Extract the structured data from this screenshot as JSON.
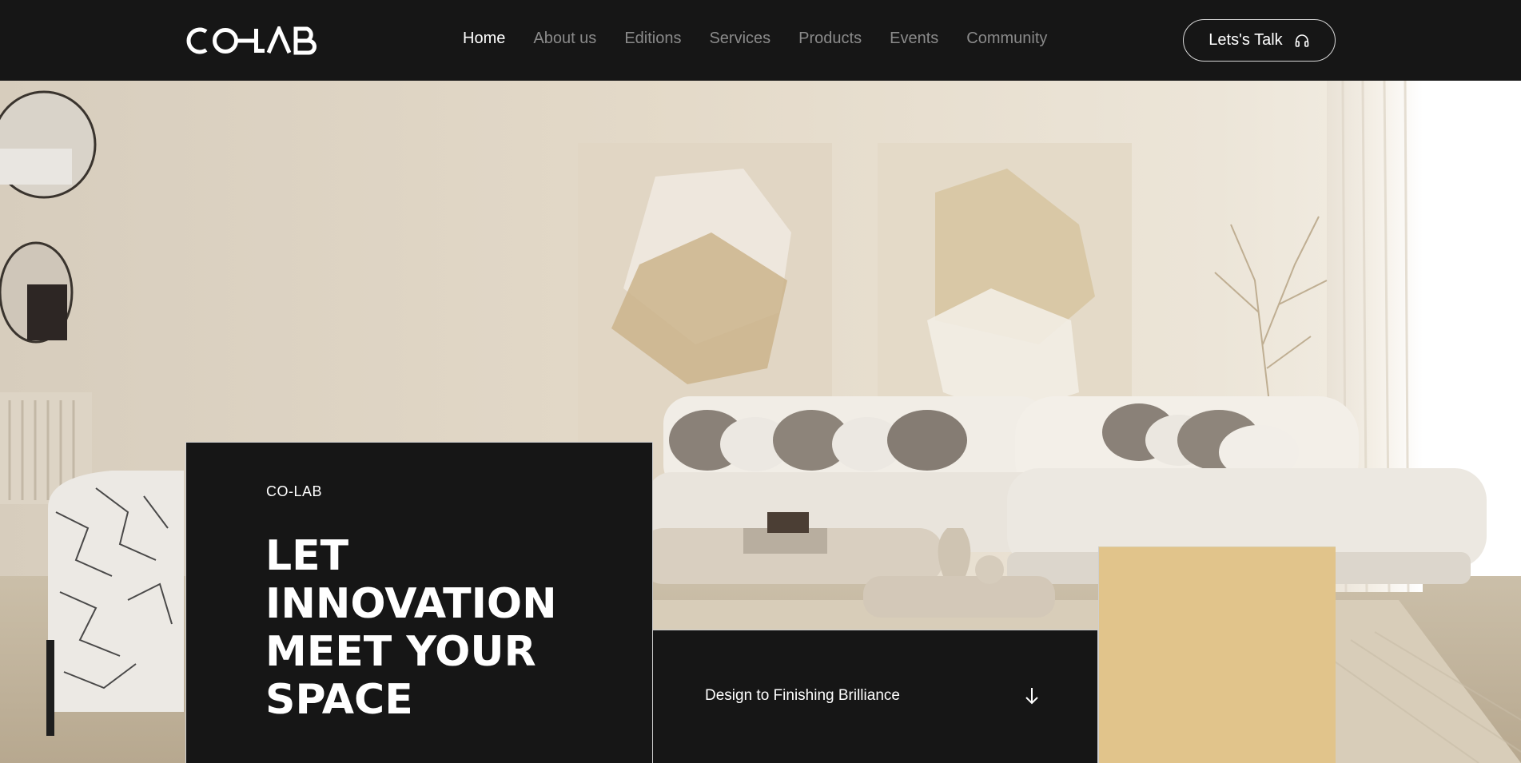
{
  "brand": {
    "logo_text": "CO—LAB"
  },
  "nav": {
    "items": [
      {
        "label": "Home",
        "active": true
      },
      {
        "label": "About us",
        "active": false
      },
      {
        "label": "Editions",
        "active": false
      },
      {
        "label": "Services",
        "active": false
      },
      {
        "label": "Products",
        "active": false
      },
      {
        "label": "Events",
        "active": false
      },
      {
        "label": "Community",
        "active": false
      }
    ]
  },
  "cta": {
    "label": "Lets's Talk",
    "icon": "headphones-icon"
  },
  "hero": {
    "eyebrow": "CO-LAB",
    "headline": "LET INNOVATION MEET YOUR SPACE",
    "sub_card_label": "Design to Finishing Brilliance",
    "sub_card_icon": "arrow-down-icon"
  },
  "colors": {
    "background": "#161616",
    "accent_gold": "#e1c48b",
    "nav_active": "#ffffff",
    "nav_inactive": "#8a8a8a"
  }
}
